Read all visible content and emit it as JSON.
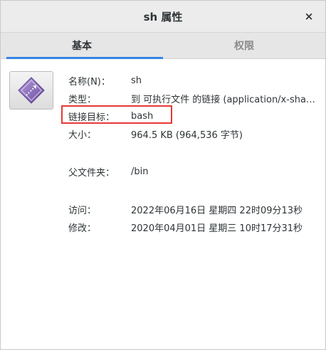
{
  "window": {
    "title": "sh 属性",
    "close_glyph": "×"
  },
  "tabs": [
    {
      "label": "基本",
      "active": true
    },
    {
      "label": "权限",
      "active": false
    }
  ],
  "icon": {
    "name": "symlink-executable-icon"
  },
  "properties": {
    "name": {
      "label": "名称(N)：",
      "value": "sh"
    },
    "type": {
      "label": "类型：",
      "value": "到 可执行文件 的链接 (application/x-sharedlib)"
    },
    "link_target": {
      "label": "链接目标：",
      "value": "bash"
    },
    "size": {
      "label": "大小：",
      "value": "964.5 KB (964,536 字节)"
    },
    "parent": {
      "label": "父文件夹：",
      "value": "/bin"
    },
    "accessed": {
      "label": "访问：",
      "value": "2022年06月16日 星期四 22时09分13秒"
    },
    "modified": {
      "label": "修改：",
      "value": "2020年04月01日 星期三 10时17分31秒"
    }
  },
  "colors": {
    "accent": "#3584e4",
    "highlight": "#e53935",
    "icon_purple": "#8e6bbf"
  }
}
